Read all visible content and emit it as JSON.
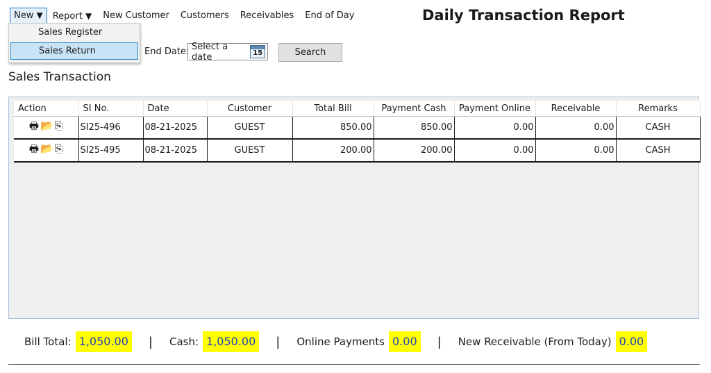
{
  "menu": {
    "new_label": "New",
    "report_label": "Report",
    "new_customer_label": "New Customer",
    "customers_label": "Customers",
    "receivables_label": "Receivables",
    "end_of_day_label": "End of Day",
    "dropdown_arrow": "▼"
  },
  "dropdown": {
    "items": [
      {
        "label": "Sales Register"
      },
      {
        "label": "Sales Return"
      }
    ]
  },
  "page_title": "Daily Transaction Report",
  "filter": {
    "end_date_label": "End Date:",
    "date_placeholder": "Select a date",
    "calendar_day": "15",
    "search_label": "Search"
  },
  "section_title": "Sales Transaction",
  "table": {
    "headers": [
      "Action",
      "SI No.",
      "Date",
      "Customer",
      "Total Bill",
      "Payment Cash",
      "Payment Online",
      "Receivable",
      "Remarks"
    ],
    "rows": [
      {
        "si_no": "SI25-496",
        "date": "08-21-2025",
        "customer": "GUEST",
        "total_bill": "850.00",
        "payment_cash": "850.00",
        "payment_online": "0.00",
        "receivable": "0.00",
        "remarks": "CASH"
      },
      {
        "si_no": "SI25-495",
        "date": "08-21-2025",
        "customer": "GUEST",
        "total_bill": "200.00",
        "payment_cash": "200.00",
        "payment_online": "0.00",
        "receivable": "0.00",
        "remarks": "CASH"
      }
    ],
    "action_icons": [
      "print-icon",
      "folder-open-icon",
      "copy-icon"
    ]
  },
  "summary": {
    "bill_total_label": "Bill Total:",
    "bill_total_value": "1,050.00",
    "cash_label": "Cash:",
    "cash_value": "1,050.00",
    "online_label": "Online Payments",
    "online_value": "0.00",
    "receivable_label": "New Receivable (From Today)",
    "receivable_value": "0.00",
    "separator": "|"
  },
  "colors": {
    "highlight_bg": "#ffff00",
    "highlight_text": "#1f3fbf",
    "menu_selected_bg": "#c9e3f6",
    "menu_selected_border": "#2e8bd1"
  }
}
